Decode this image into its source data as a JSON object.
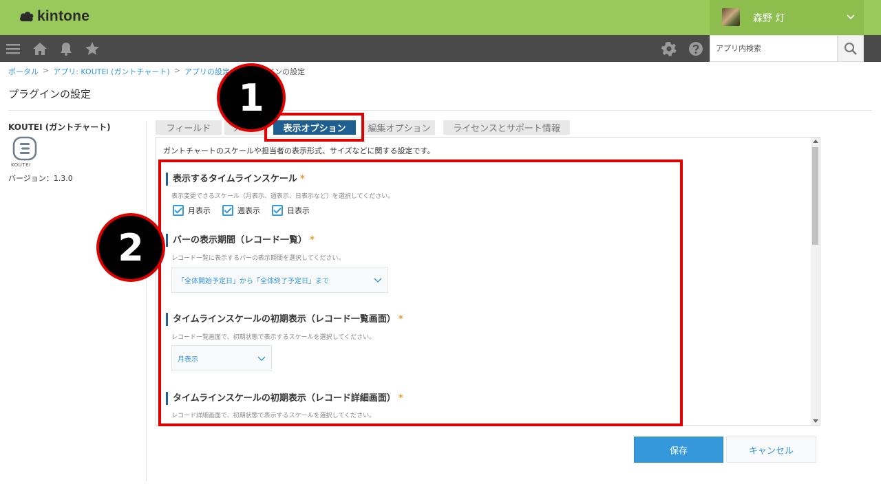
{
  "header": {
    "logo_text": "kintone",
    "user_name": "森野 灯"
  },
  "search": {
    "placeholder": "アプリ内検索"
  },
  "breadcrumb": {
    "portal": "ポータル",
    "sep": ">",
    "app": "アプリ: KOUTEI (ガントチャート)",
    "app_settings": "アプリの設定",
    "current": "プラグインの設定"
  },
  "page": {
    "title": "プラグインの設定"
  },
  "plugin": {
    "name": "KOUTEI (ガントチャート)",
    "icon_label": "KOUTEI",
    "version": "バージョン：1.3.0"
  },
  "tabs": [
    {
      "label": "フィールド"
    },
    {
      "label": "メ"
    },
    {
      "label": "表示オプション"
    },
    {
      "label": "編集オプション"
    },
    {
      "label": "ライセンスとサポート情報"
    }
  ],
  "panel": {
    "description": "ガントチャートのスケールや担当者の表示形式、サイズなどに関する設定です。"
  },
  "sections": {
    "timeline_scale": {
      "title": "表示するタイムラインスケール",
      "required": "*",
      "desc": "表示変更できるスケール（月表示、週表示、日表示など）を選択してください。",
      "options": [
        "月表示",
        "週表示",
        "日表示"
      ]
    },
    "bar_period": {
      "title": "バーの表示期間（レコード一覧）",
      "required": "*",
      "desc": "レコード一覧に表示するバーの表示期間を選択してください。",
      "selected": "「全体開始予定日」から「全体終了予定日」まで"
    },
    "initial_list": {
      "title": "タイムラインスケールの初期表示（レコード一覧画面）",
      "required": "*",
      "desc": "レコード一覧画面で、初期状態で表示するスケールを選択してください。",
      "selected": "月表示"
    },
    "initial_detail": {
      "title": "タイムラインスケールの初期表示（レコード詳細画面）",
      "required": "*",
      "desc": "レコード詳細画面で、初期状態で表示するスケールを選択してください。"
    }
  },
  "buttons": {
    "save": "保存",
    "cancel": "キャンセル"
  },
  "annotations": {
    "badge_1": "1",
    "badge_2": "2"
  },
  "colors": {
    "header_green": "#99c95a",
    "nav_dark": "#4a4a4a",
    "accent_blue": "#3498db",
    "tab_active": "#1d5f90",
    "annotation_red": "#e00000",
    "required_orange": "#e39a33"
  }
}
